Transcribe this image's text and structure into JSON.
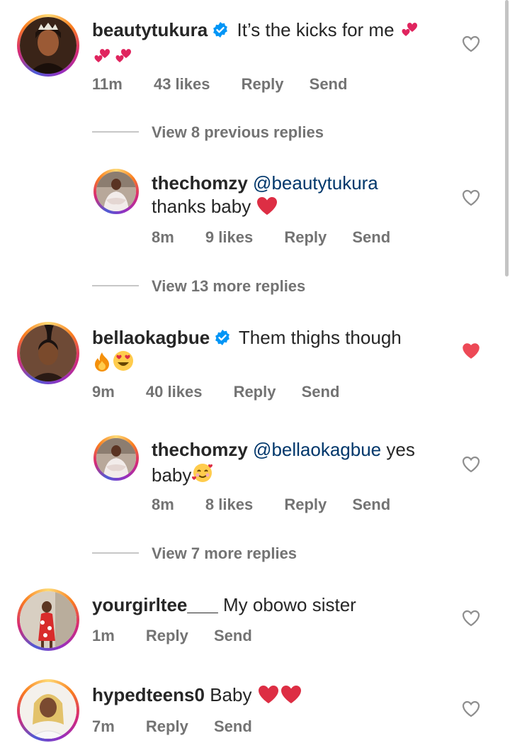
{
  "comments": [
    {
      "username": "beautytukura",
      "verified": true,
      "text": "It’s the kicks for me",
      "time": "11m",
      "likes": "43 likes",
      "reply": "Reply",
      "send": "Send",
      "liked": false
    },
    {
      "view_previous": "View 8 previous replies"
    },
    {
      "username": "thechomzy",
      "mention": "@beautytukura",
      "text": "thanks baby",
      "time": "8m",
      "likes": "9 likes",
      "reply": "Reply",
      "send": "Send",
      "liked": false,
      "view_more": "View 13 more replies"
    },
    {
      "username": "bellaokagbue",
      "verified": true,
      "text": "Them thighs though",
      "time": "9m",
      "likes": "40 likes",
      "reply": "Reply",
      "send": "Send",
      "liked": true
    },
    {
      "username": "thechomzy",
      "mention": "@bellaokagbue",
      "text": "yes baby",
      "time": "8m",
      "likes": "8 likes",
      "reply": "Reply",
      "send": "Send",
      "liked": false,
      "view_more": "View 7 more replies"
    },
    {
      "username": "yourgirltee___",
      "text": "My obowo sister",
      "time": "1m",
      "reply": "Reply",
      "send": "Send",
      "liked": false
    },
    {
      "username": "hypedteens0",
      "text": "Baby",
      "time": "7m",
      "reply": "Reply",
      "send": "Send",
      "liked": false
    }
  ],
  "colors": {
    "liked_heart": "#ed4956",
    "verified": "#0095f6",
    "mention": "#00376b",
    "meta": "#737373"
  }
}
